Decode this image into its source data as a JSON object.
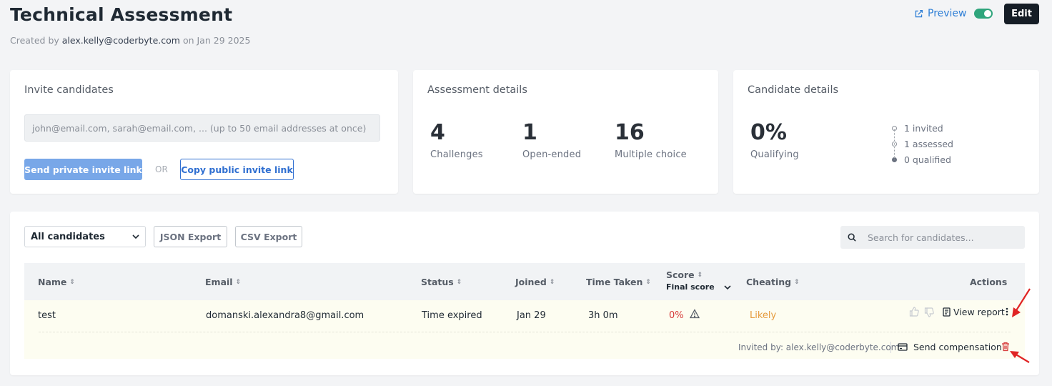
{
  "header": {
    "title": "Technical Assessment",
    "created_prefix": "Created by",
    "created_by": "alex.kelly@coderbyte.com",
    "created_on_prefix": "on",
    "created_date": "Jan 29 2025",
    "preview_label": "Preview",
    "edit_label": "Edit"
  },
  "invite": {
    "title": "Invite candidates",
    "placeholder": "john@email.com, sarah@email.com, ... (up to 50 email addresses at once)",
    "send_private_label": "Send private invite link",
    "or_label": "OR",
    "copy_public_label": "Copy public invite link"
  },
  "assessment": {
    "title": "Assessment details",
    "stats": [
      {
        "num": "4",
        "label": "Challenges"
      },
      {
        "num": "1",
        "label": "Open-ended"
      },
      {
        "num": "16",
        "label": "Multiple choice"
      }
    ]
  },
  "candidate_details": {
    "title": "Candidate details",
    "qualifying_pct": "0%",
    "qualifying_label": "Qualifying",
    "items": [
      "1 invited",
      "1 assessed",
      "0 qualified"
    ]
  },
  "toolbar": {
    "filter_value": "All candidates",
    "json_export": "JSON Export",
    "csv_export": "CSV Export",
    "search_placeholder": "Search for candidates..."
  },
  "table": {
    "headers": {
      "name": "Name",
      "email": "Email",
      "status": "Status",
      "joined": "Joined",
      "time": "Time Taken",
      "score": "Score",
      "score_sub": "Final score",
      "cheating": "Cheating",
      "actions": "Actions"
    },
    "row": {
      "name": "test",
      "email": "domanski.alexandra8@gmail.com",
      "status": "Time expired",
      "joined": "Jan 29",
      "time": "3h 0m",
      "score": "0%",
      "cheating": "Likely",
      "view_report": "View report",
      "invited_by": "Invited by: alex.kelly@coderbyte.com",
      "send_compensation": "Send compensation"
    }
  },
  "colors": {
    "accent": "#2f7fd6",
    "toggle": "#2fa57c",
    "score_red": "#d63a3a",
    "cheating_orange": "#e59a3c",
    "annotation_red": "#e02424"
  }
}
